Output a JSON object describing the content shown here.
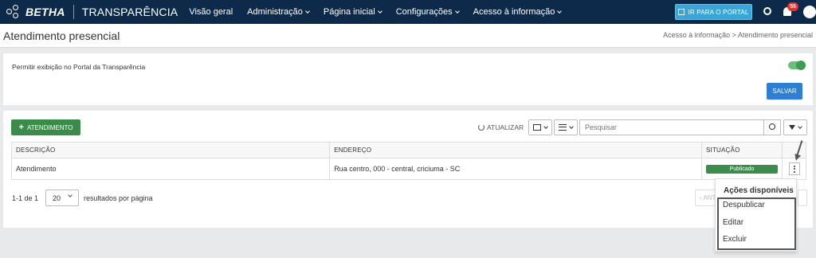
{
  "brand": {
    "logo_text": "BETHA",
    "product": "TRANSPARÊNCIA"
  },
  "nav": [
    {
      "label": "Visão geral",
      "has_menu": false
    },
    {
      "label": "Administração",
      "has_menu": true
    },
    {
      "label": "Página inicial",
      "has_menu": true
    },
    {
      "label": "Configurações",
      "has_menu": true
    },
    {
      "label": "Acesso à informação",
      "has_menu": true
    }
  ],
  "topbar": {
    "portal_button": "IR PARA O PORTAL",
    "notification_count": "55"
  },
  "page": {
    "title": "Atendimento presencial",
    "breadcrumb": "Acesso à informação > Atendimento presencial"
  },
  "settings": {
    "toggle_label": "Permitir exibição no Portal da Transparência",
    "toggle_on": true,
    "save_label": "SALVAR"
  },
  "toolbar": {
    "add_label": "ATENDIMENTO",
    "refresh_label": "ATUALIZAR",
    "search_placeholder": "Pesquisar"
  },
  "table": {
    "headers": [
      "DESCRIÇÃO",
      "ENDEREÇO",
      "SITUAÇÃO"
    ],
    "rows": [
      {
        "descricao": "Atendimento",
        "endereco": "Rua centro, 000 - central, criciuma - SC",
        "situacao": "Publicado"
      }
    ]
  },
  "pagination": {
    "count": "1-1 de 1",
    "per_page": "20",
    "per_page_label": "resultados por página",
    "prev_label": "‹ ANTERIOR"
  },
  "menu": {
    "header": "Ações disponíveis",
    "items": [
      "Despublicar",
      "Editar",
      "Excluir"
    ]
  },
  "colors": {
    "navbar": "#0e2a4a",
    "primary": "#2e7ed4",
    "success": "#3b8b4a",
    "portal": "#3aa6d8",
    "badge": "#e2322f"
  }
}
